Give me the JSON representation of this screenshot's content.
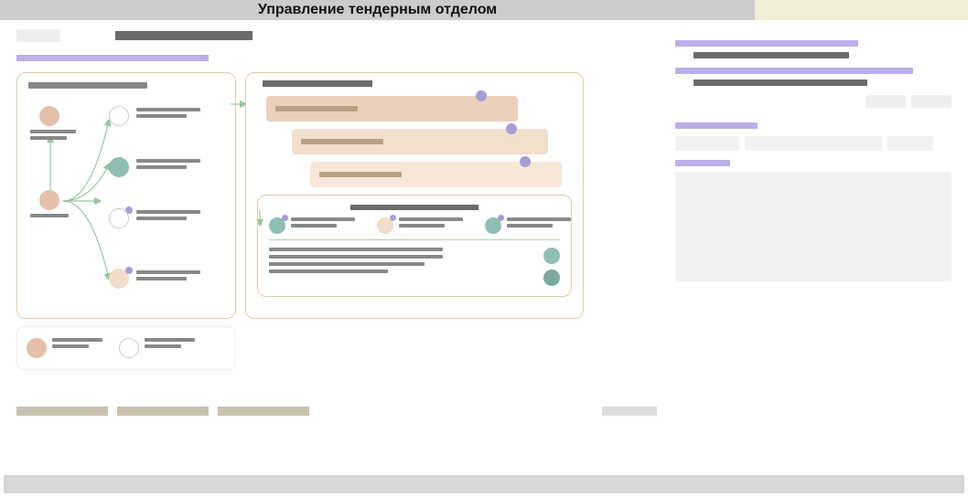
{
  "window": {
    "title": "Управление тендерным отделом"
  },
  "colors": {
    "accent_purple": "#bcaee8",
    "peach": "#e3c0a9",
    "peach_light": "#f0ddca",
    "teal": "#8fbfb4",
    "panel_border": "#e3c9a8"
  },
  "left": {
    "header_button": "",
    "header_title": "",
    "section_label": "",
    "graph_panel": {
      "title": "",
      "nodes": [
        {
          "id": "root-a",
          "color": "peach",
          "label": ""
        },
        {
          "id": "root-b",
          "color": "peach",
          "label": ""
        },
        {
          "id": "branch-1",
          "color": "white",
          "label": ""
        },
        {
          "id": "branch-2",
          "color": "teal",
          "label": ""
        },
        {
          "id": "branch-3",
          "color": "white",
          "label": "",
          "badge": true
        },
        {
          "id": "branch-4",
          "color": "peach_light",
          "label": "",
          "badge": true
        }
      ]
    },
    "mini_panel": {
      "items": [
        {
          "color": "peach",
          "label": ""
        },
        {
          "color": "white",
          "label": ""
        }
      ]
    },
    "stages_panel": {
      "title": "",
      "stages": [
        {
          "id": "s1",
          "label": "",
          "badge": true
        },
        {
          "id": "s2",
          "label": "",
          "badge": true
        },
        {
          "id": "s3",
          "label": "",
          "badge": true
        }
      ],
      "sub": {
        "title": "",
        "row_items": [
          {
            "color": "teal"
          },
          {
            "color": "peach_light"
          },
          {
            "color": "teal"
          }
        ],
        "legend": [
          {
            "color": "teal"
          },
          {
            "color": "teal"
          }
        ]
      }
    },
    "tabs": [
      "",
      "",
      ""
    ]
  },
  "right": {
    "block1": {
      "lines": [
        "",
        "",
        "",
        ""
      ]
    },
    "buttons": [
      "",
      ""
    ],
    "section2": {
      "label": ""
    },
    "fields": [
      "",
      "",
      ""
    ],
    "section3": {
      "label": ""
    },
    "textarea": ""
  }
}
